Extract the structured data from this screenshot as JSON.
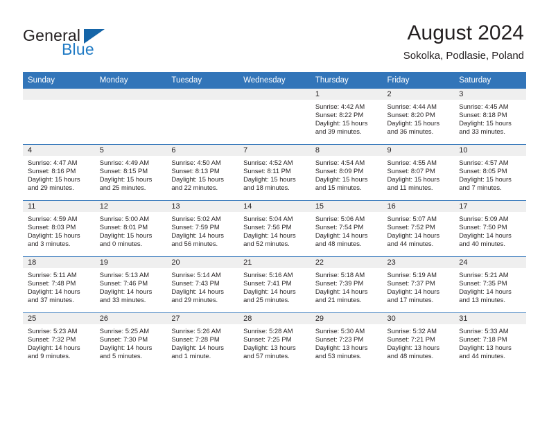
{
  "brand": {
    "name_part1": "General",
    "name_part2": "Blue",
    "triangle_color": "#1565a8",
    "blue_color": "#1f7ac4"
  },
  "header": {
    "title": "August 2024",
    "subtitle": "Sokolka, Podlasie, Poland",
    "header_bg_color": "#3275b9",
    "daynum_band_color": "#efefef"
  },
  "weekdays": [
    "Sunday",
    "Monday",
    "Tuesday",
    "Wednesday",
    "Thursday",
    "Friday",
    "Saturday"
  ],
  "weeks": [
    [
      {
        "empty": true
      },
      {
        "empty": true
      },
      {
        "empty": true
      },
      {
        "empty": true
      },
      {
        "day": "1",
        "sunrise": "Sunrise: 4:42 AM",
        "sunset": "Sunset: 8:22 PM",
        "daylight_line1": "Daylight: 15 hours",
        "daylight_line2": "and 39 minutes."
      },
      {
        "day": "2",
        "sunrise": "Sunrise: 4:44 AM",
        "sunset": "Sunset: 8:20 PM",
        "daylight_line1": "Daylight: 15 hours",
        "daylight_line2": "and 36 minutes."
      },
      {
        "day": "3",
        "sunrise": "Sunrise: 4:45 AM",
        "sunset": "Sunset: 8:18 PM",
        "daylight_line1": "Daylight: 15 hours",
        "daylight_line2": "and 33 minutes."
      }
    ],
    [
      {
        "day": "4",
        "sunrise": "Sunrise: 4:47 AM",
        "sunset": "Sunset: 8:16 PM",
        "daylight_line1": "Daylight: 15 hours",
        "daylight_line2": "and 29 minutes."
      },
      {
        "day": "5",
        "sunrise": "Sunrise: 4:49 AM",
        "sunset": "Sunset: 8:15 PM",
        "daylight_line1": "Daylight: 15 hours",
        "daylight_line2": "and 25 minutes."
      },
      {
        "day": "6",
        "sunrise": "Sunrise: 4:50 AM",
        "sunset": "Sunset: 8:13 PM",
        "daylight_line1": "Daylight: 15 hours",
        "daylight_line2": "and 22 minutes."
      },
      {
        "day": "7",
        "sunrise": "Sunrise: 4:52 AM",
        "sunset": "Sunset: 8:11 PM",
        "daylight_line1": "Daylight: 15 hours",
        "daylight_line2": "and 18 minutes."
      },
      {
        "day": "8",
        "sunrise": "Sunrise: 4:54 AM",
        "sunset": "Sunset: 8:09 PM",
        "daylight_line1": "Daylight: 15 hours",
        "daylight_line2": "and 15 minutes."
      },
      {
        "day": "9",
        "sunrise": "Sunrise: 4:55 AM",
        "sunset": "Sunset: 8:07 PM",
        "daylight_line1": "Daylight: 15 hours",
        "daylight_line2": "and 11 minutes."
      },
      {
        "day": "10",
        "sunrise": "Sunrise: 4:57 AM",
        "sunset": "Sunset: 8:05 PM",
        "daylight_line1": "Daylight: 15 hours",
        "daylight_line2": "and 7 minutes."
      }
    ],
    [
      {
        "day": "11",
        "sunrise": "Sunrise: 4:59 AM",
        "sunset": "Sunset: 8:03 PM",
        "daylight_line1": "Daylight: 15 hours",
        "daylight_line2": "and 3 minutes."
      },
      {
        "day": "12",
        "sunrise": "Sunrise: 5:00 AM",
        "sunset": "Sunset: 8:01 PM",
        "daylight_line1": "Daylight: 15 hours",
        "daylight_line2": "and 0 minutes."
      },
      {
        "day": "13",
        "sunrise": "Sunrise: 5:02 AM",
        "sunset": "Sunset: 7:59 PM",
        "daylight_line1": "Daylight: 14 hours",
        "daylight_line2": "and 56 minutes."
      },
      {
        "day": "14",
        "sunrise": "Sunrise: 5:04 AM",
        "sunset": "Sunset: 7:56 PM",
        "daylight_line1": "Daylight: 14 hours",
        "daylight_line2": "and 52 minutes."
      },
      {
        "day": "15",
        "sunrise": "Sunrise: 5:06 AM",
        "sunset": "Sunset: 7:54 PM",
        "daylight_line1": "Daylight: 14 hours",
        "daylight_line2": "and 48 minutes."
      },
      {
        "day": "16",
        "sunrise": "Sunrise: 5:07 AM",
        "sunset": "Sunset: 7:52 PM",
        "daylight_line1": "Daylight: 14 hours",
        "daylight_line2": "and 44 minutes."
      },
      {
        "day": "17",
        "sunrise": "Sunrise: 5:09 AM",
        "sunset": "Sunset: 7:50 PM",
        "daylight_line1": "Daylight: 14 hours",
        "daylight_line2": "and 40 minutes."
      }
    ],
    [
      {
        "day": "18",
        "sunrise": "Sunrise: 5:11 AM",
        "sunset": "Sunset: 7:48 PM",
        "daylight_line1": "Daylight: 14 hours",
        "daylight_line2": "and 37 minutes."
      },
      {
        "day": "19",
        "sunrise": "Sunrise: 5:13 AM",
        "sunset": "Sunset: 7:46 PM",
        "daylight_line1": "Daylight: 14 hours",
        "daylight_line2": "and 33 minutes."
      },
      {
        "day": "20",
        "sunrise": "Sunrise: 5:14 AM",
        "sunset": "Sunset: 7:43 PM",
        "daylight_line1": "Daylight: 14 hours",
        "daylight_line2": "and 29 minutes."
      },
      {
        "day": "21",
        "sunrise": "Sunrise: 5:16 AM",
        "sunset": "Sunset: 7:41 PM",
        "daylight_line1": "Daylight: 14 hours",
        "daylight_line2": "and 25 minutes."
      },
      {
        "day": "22",
        "sunrise": "Sunrise: 5:18 AM",
        "sunset": "Sunset: 7:39 PM",
        "daylight_line1": "Daylight: 14 hours",
        "daylight_line2": "and 21 minutes."
      },
      {
        "day": "23",
        "sunrise": "Sunrise: 5:19 AM",
        "sunset": "Sunset: 7:37 PM",
        "daylight_line1": "Daylight: 14 hours",
        "daylight_line2": "and 17 minutes."
      },
      {
        "day": "24",
        "sunrise": "Sunrise: 5:21 AM",
        "sunset": "Sunset: 7:35 PM",
        "daylight_line1": "Daylight: 14 hours",
        "daylight_line2": "and 13 minutes."
      }
    ],
    [
      {
        "day": "25",
        "sunrise": "Sunrise: 5:23 AM",
        "sunset": "Sunset: 7:32 PM",
        "daylight_line1": "Daylight: 14 hours",
        "daylight_line2": "and 9 minutes."
      },
      {
        "day": "26",
        "sunrise": "Sunrise: 5:25 AM",
        "sunset": "Sunset: 7:30 PM",
        "daylight_line1": "Daylight: 14 hours",
        "daylight_line2": "and 5 minutes."
      },
      {
        "day": "27",
        "sunrise": "Sunrise: 5:26 AM",
        "sunset": "Sunset: 7:28 PM",
        "daylight_line1": "Daylight: 14 hours",
        "daylight_line2": "and 1 minute."
      },
      {
        "day": "28",
        "sunrise": "Sunrise: 5:28 AM",
        "sunset": "Sunset: 7:25 PM",
        "daylight_line1": "Daylight: 13 hours",
        "daylight_line2": "and 57 minutes."
      },
      {
        "day": "29",
        "sunrise": "Sunrise: 5:30 AM",
        "sunset": "Sunset: 7:23 PM",
        "daylight_line1": "Daylight: 13 hours",
        "daylight_line2": "and 53 minutes."
      },
      {
        "day": "30",
        "sunrise": "Sunrise: 5:32 AM",
        "sunset": "Sunset: 7:21 PM",
        "daylight_line1": "Daylight: 13 hours",
        "daylight_line2": "and 48 minutes."
      },
      {
        "day": "31",
        "sunrise": "Sunrise: 5:33 AM",
        "sunset": "Sunset: 7:18 PM",
        "daylight_line1": "Daylight: 13 hours",
        "daylight_line2": "and 44 minutes."
      }
    ]
  ]
}
